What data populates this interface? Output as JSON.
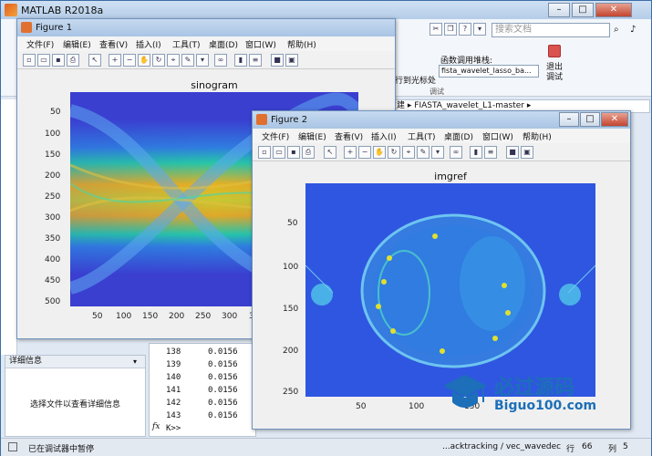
{
  "main_window": {
    "title": "MATLAB R2018a",
    "search_placeholder": "搜索文档",
    "call_stack_label": "函数调用堆栈:",
    "call_stack_value": "fista_wavelet_lasso_ba...",
    "exit_debug_label": "退出\n调试",
    "run_to_cursor": "行到光标处",
    "debug_section": "调试",
    "path_items": [
      "重建",
      "FIASTA_wavelet_L1-master"
    ],
    "detail_header": "详细信息",
    "detail_text": "选择文件以查看详细信息",
    "prompt": "K>>",
    "status_left": "已在调试器中暂停",
    "status_func": "...acktracking / vec_wavedec",
    "status_row_label": "行",
    "status_row": "66",
    "status_col_label": "列",
    "status_col": "5",
    "cmd_rows": [
      {
        "n": "138",
        "v": "0.0156"
      },
      {
        "n": "139",
        "v": "0.0156"
      },
      {
        "n": "140",
        "v": "0.0156"
      },
      {
        "n": "141",
        "v": "0.0156"
      },
      {
        "n": "142",
        "v": "0.0156"
      },
      {
        "n": "143",
        "v": "0.0156"
      }
    ]
  },
  "figure1": {
    "title": "Figure 1",
    "menu": [
      "文件(F)",
      "编辑(E)",
      "查看(V)",
      "插入(I)",
      "工具(T)",
      "桌面(D)",
      "窗口(W)",
      "帮助(H)"
    ],
    "chart_title": "sinogram",
    "yticks": [
      "50",
      "100",
      "150",
      "200",
      "250",
      "300",
      "350",
      "400",
      "450",
      "500"
    ],
    "xticks": [
      "50",
      "100",
      "150",
      "200",
      "250",
      "300",
      "3"
    ]
  },
  "figure2": {
    "title": "Figure 2",
    "menu": [
      "文件(F)",
      "编辑(E)",
      "查看(V)",
      "插入(I)",
      "工具(T)",
      "桌面(D)",
      "窗口(W)",
      "帮助(H)"
    ],
    "chart_title": "imgref",
    "yticks": [
      "50",
      "100",
      "150",
      "200",
      "250"
    ],
    "xticks": [
      "50",
      "100",
      "150"
    ]
  },
  "watermark": {
    "line1": "必过源码",
    "line2": "Biguo100.com"
  },
  "colors": {
    "plot_bg": "#3a3fd0",
    "plot_bg2": "#2f56e0",
    "sino_band": "#26c6a8",
    "sino_hot": "#f0b020"
  }
}
